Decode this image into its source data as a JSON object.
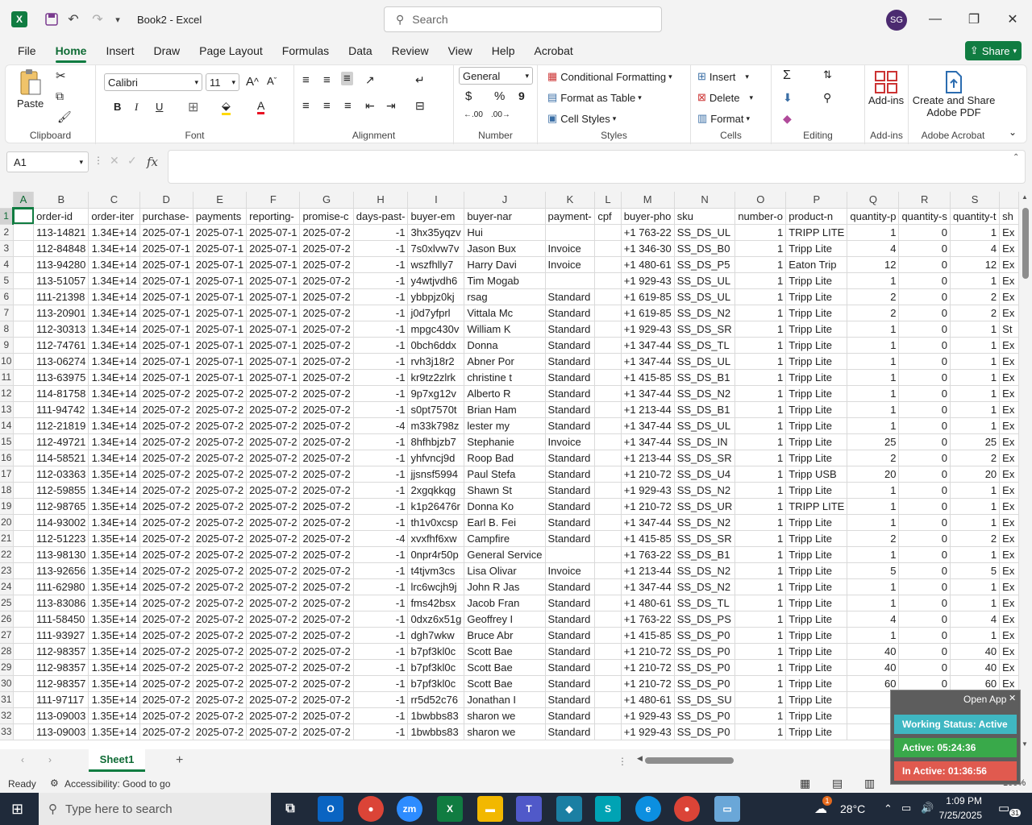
{
  "title_bar": {
    "doc_title": "Book2  -  Excel",
    "search_placeholder": "Search",
    "avatar_initials": "SG"
  },
  "menu": {
    "items": [
      "File",
      "Home",
      "Insert",
      "Draw",
      "Page Layout",
      "Formulas",
      "Data",
      "Review",
      "View",
      "Help",
      "Acrobat"
    ],
    "active": "Home",
    "share_label": "Share"
  },
  "ribbon": {
    "clipboard": {
      "paste": "Paste",
      "label": "Clipboard"
    },
    "font": {
      "name": "Calibri",
      "size": "11",
      "label": "Font",
      "bold": "B",
      "italic": "I",
      "underline": "U"
    },
    "alignment": {
      "label": "Alignment"
    },
    "number": {
      "format": "General",
      "label": "Number",
      "currency": "$",
      "percent": "%",
      "comma": "9"
    },
    "styles": {
      "conditional": "Conditional Formatting",
      "table": "Format as Table",
      "cell": "Cell Styles",
      "label": "Styles"
    },
    "cells": {
      "insert": "Insert",
      "delete": "Delete",
      "format": "Format",
      "label": "Cells"
    },
    "editing": {
      "label": "Editing"
    },
    "addins": {
      "button": "Add-ins",
      "label": "Add-ins"
    },
    "acrobat": {
      "button_line1": "Create and Share",
      "button_line2": "Adobe PDF",
      "label": "Adobe Acrobat"
    }
  },
  "formula_bar": {
    "name_box": "A1",
    "fx": "fx",
    "value": ""
  },
  "grid": {
    "columns": [
      "A",
      "B",
      "C",
      "D",
      "E",
      "F",
      "G",
      "H",
      "I",
      "J",
      "K",
      "L",
      "M",
      "N",
      "O",
      "P",
      "Q",
      "R",
      "S"
    ],
    "header_row": [
      "",
      "order-id",
      "order-iter",
      "purchase-",
      "payments",
      "reporting-",
      "promise-c",
      "days-past-",
      "buyer-em",
      "buyer-nar",
      "payment-",
      "cpf",
      "buyer-pho",
      "sku",
      "number-o",
      "product-n",
      "quantity-p",
      "quantity-s",
      "quantity-t",
      "sh"
    ],
    "rows": [
      [
        "2",
        "",
        "113-14821",
        "1.34E+14",
        "2025-07-1",
        "2025-07-1",
        "2025-07-1",
        "2025-07-2",
        "-1",
        "3hx35yqzv",
        "Hui",
        "",
        "",
        "+1 763-22",
        "SS_DS_UL",
        "1",
        "TRIPP LITE",
        "1",
        "0",
        "1",
        "Ex"
      ],
      [
        "3",
        "",
        "112-84848",
        "1.34E+14",
        "2025-07-1",
        "2025-07-1",
        "2025-07-1",
        "2025-07-2",
        "-1",
        "7s0xlvw7v",
        "Jason Bux",
        "Invoice",
        "",
        "+1 346-30",
        "SS_DS_B0",
        "1",
        "Tripp Lite",
        "4",
        "0",
        "4",
        "Ex"
      ],
      [
        "4",
        "",
        "113-94280",
        "1.34E+14",
        "2025-07-1",
        "2025-07-1",
        "2025-07-1",
        "2025-07-2",
        "-1",
        "wszfhlly7",
        "Harry Davi",
        "Invoice",
        "",
        "+1 480-61",
        "SS_DS_P5",
        "1",
        "Eaton Trip",
        "12",
        "0",
        "12",
        "Ex"
      ],
      [
        "5",
        "",
        "113-51057",
        "1.34E+14",
        "2025-07-1",
        "2025-07-1",
        "2025-07-1",
        "2025-07-2",
        "-1",
        "y4wtjvdh6",
        "Tim Mogab",
        "",
        "",
        "+1 929-43",
        "SS_DS_UL",
        "1",
        "Tripp Lite",
        "1",
        "0",
        "1",
        "Ex"
      ],
      [
        "6",
        "",
        "111-21398",
        "1.34E+14",
        "2025-07-1",
        "2025-07-1",
        "2025-07-1",
        "2025-07-2",
        "-1",
        "ybbpjz0kj",
        "rsag",
        "Standard",
        "",
        "+1 619-85",
        "SS_DS_UL",
        "1",
        "Tripp Lite",
        "2",
        "0",
        "2",
        "Ex"
      ],
      [
        "7",
        "",
        "113-20901",
        "1.34E+14",
        "2025-07-1",
        "2025-07-1",
        "2025-07-1",
        "2025-07-2",
        "-1",
        "j0d7yfprl",
        "Vittala Mc",
        "Standard",
        "",
        "+1 619-85",
        "SS_DS_N2",
        "1",
        "Tripp Lite",
        "2",
        "0",
        "2",
        "Ex"
      ],
      [
        "8",
        "",
        "112-30313",
        "1.34E+14",
        "2025-07-1",
        "2025-07-1",
        "2025-07-1",
        "2025-07-2",
        "-1",
        "mpgc430v",
        "William K",
        "Standard",
        "",
        "+1 929-43",
        "SS_DS_SR",
        "1",
        "Tripp Lite",
        "1",
        "0",
        "1",
        "St"
      ],
      [
        "9",
        "",
        "112-74761",
        "1.34E+14",
        "2025-07-1",
        "2025-07-1",
        "2025-07-1",
        "2025-07-2",
        "-1",
        "0bch6ddx",
        "Donna",
        "Standard",
        "",
        "+1 347-44",
        "SS_DS_TL",
        "1",
        "Tripp Lite",
        "1",
        "0",
        "1",
        "Ex"
      ],
      [
        "10",
        "",
        "113-06274",
        "1.34E+14",
        "2025-07-1",
        "2025-07-1",
        "2025-07-1",
        "2025-07-2",
        "-1",
        "rvh3j18r2",
        "Abner Por",
        "Standard",
        "",
        "+1 347-44",
        "SS_DS_UL",
        "1",
        "Tripp Lite",
        "1",
        "0",
        "1",
        "Ex"
      ],
      [
        "11",
        "",
        "113-63975",
        "1.34E+14",
        "2025-07-1",
        "2025-07-1",
        "2025-07-1",
        "2025-07-2",
        "-1",
        "kr9tz2zlrk",
        "christine t",
        "Standard",
        "",
        "+1 415-85",
        "SS_DS_B1",
        "1",
        "Tripp Lite",
        "1",
        "0",
        "1",
        "Ex"
      ],
      [
        "12",
        "",
        "114-81758",
        "1.34E+14",
        "2025-07-2",
        "2025-07-2",
        "2025-07-2",
        "2025-07-2",
        "-1",
        "9p7xg12v",
        "Alberto R",
        "Standard",
        "",
        "+1 347-44",
        "SS_DS_N2",
        "1",
        "Tripp Lite",
        "1",
        "0",
        "1",
        "Ex"
      ],
      [
        "13",
        "",
        "111-94742",
        "1.34E+14",
        "2025-07-2",
        "2025-07-2",
        "2025-07-2",
        "2025-07-2",
        "-1",
        "s0pt7570t",
        "Brian Ham",
        "Standard",
        "",
        "+1 213-44",
        "SS_DS_B1",
        "1",
        "Tripp Lite",
        "1",
        "0",
        "1",
        "Ex"
      ],
      [
        "14",
        "",
        "112-21819",
        "1.34E+14",
        "2025-07-2",
        "2025-07-2",
        "2025-07-2",
        "2025-07-2",
        "-4",
        "m33k798z",
        "lester my",
        "Standard",
        "",
        "+1 347-44",
        "SS_DS_UL",
        "1",
        "Tripp Lite",
        "1",
        "0",
        "1",
        "Ex"
      ],
      [
        "15",
        "",
        "112-49721",
        "1.34E+14",
        "2025-07-2",
        "2025-07-2",
        "2025-07-2",
        "2025-07-2",
        "-1",
        "8hfhbjzb7",
        "Stephanie",
        "Invoice",
        "",
        "+1 347-44",
        "SS_DS_IN",
        "1",
        "Tripp Lite",
        "25",
        "0",
        "25",
        "Ex"
      ],
      [
        "16",
        "",
        "114-58521",
        "1.34E+14",
        "2025-07-2",
        "2025-07-2",
        "2025-07-2",
        "2025-07-2",
        "-1",
        "yhfvncj9d",
        "Roop Bad",
        "Standard",
        "",
        "+1 213-44",
        "SS_DS_SR",
        "1",
        "Tripp Lite",
        "2",
        "0",
        "2",
        "Ex"
      ],
      [
        "17",
        "",
        "112-03363",
        "1.35E+14",
        "2025-07-2",
        "2025-07-2",
        "2025-07-2",
        "2025-07-2",
        "-1",
        "jjsnsf5994",
        "Paul Stefa",
        "Standard",
        "",
        "+1 210-72",
        "SS_DS_U4",
        "1",
        "Tripp USB",
        "20",
        "0",
        "20",
        "Ex"
      ],
      [
        "18",
        "",
        "112-59855",
        "1.34E+14",
        "2025-07-2",
        "2025-07-2",
        "2025-07-2",
        "2025-07-2",
        "-1",
        "2xgqkkqg",
        "Shawn St",
        "Standard",
        "",
        "+1 929-43",
        "SS_DS_N2",
        "1",
        "Tripp Lite",
        "1",
        "0",
        "1",
        "Ex"
      ],
      [
        "19",
        "",
        "112-98765",
        "1.35E+14",
        "2025-07-2",
        "2025-07-2",
        "2025-07-2",
        "2025-07-2",
        "-1",
        "k1p26476r",
        "Donna Ko",
        "Standard",
        "",
        "+1 210-72",
        "SS_DS_UR",
        "1",
        "TRIPP LITE",
        "1",
        "0",
        "1",
        "Ex"
      ],
      [
        "20",
        "",
        "114-93002",
        "1.34E+14",
        "2025-07-2",
        "2025-07-2",
        "2025-07-2",
        "2025-07-2",
        "-1",
        "th1v0xcsp",
        "Earl B. Fei",
        "Standard",
        "",
        "+1 347-44",
        "SS_DS_N2",
        "1",
        "Tripp Lite",
        "1",
        "0",
        "1",
        "Ex"
      ],
      [
        "21",
        "",
        "112-51223",
        "1.35E+14",
        "2025-07-2",
        "2025-07-2",
        "2025-07-2",
        "2025-07-2",
        "-4",
        "xvxfhf6xw",
        "Campfire",
        "Standard",
        "",
        "+1 415-85",
        "SS_DS_SR",
        "1",
        "Tripp Lite",
        "2",
        "0",
        "2",
        "Ex"
      ],
      [
        "22",
        "",
        "113-98130",
        "1.35E+14",
        "2025-07-2",
        "2025-07-2",
        "2025-07-2",
        "2025-07-2",
        "-1",
        "0npr4r50p",
        "General Service",
        "",
        "",
        "+1 763-22",
        "SS_DS_B1",
        "1",
        "Tripp Lite",
        "1",
        "0",
        "1",
        "Ex"
      ],
      [
        "23",
        "",
        "113-92656",
        "1.35E+14",
        "2025-07-2",
        "2025-07-2",
        "2025-07-2",
        "2025-07-2",
        "-1",
        "t4tjvm3cs",
        "Lisa Olivar",
        "Invoice",
        "",
        "+1 213-44",
        "SS_DS_N2",
        "1",
        "Tripp Lite",
        "5",
        "0",
        "5",
        "Ex"
      ],
      [
        "24",
        "",
        "111-62980",
        "1.35E+14",
        "2025-07-2",
        "2025-07-2",
        "2025-07-2",
        "2025-07-2",
        "-1",
        "lrc6wcjh9j",
        "John R Jas",
        "Standard",
        "",
        "+1 347-44",
        "SS_DS_N2",
        "1",
        "Tripp Lite",
        "1",
        "0",
        "1",
        "Ex"
      ],
      [
        "25",
        "",
        "113-83086",
        "1.35E+14",
        "2025-07-2",
        "2025-07-2",
        "2025-07-2",
        "2025-07-2",
        "-1",
        "fms42bsx",
        "Jacob Fran",
        "Standard",
        "",
        "+1 480-61",
        "SS_DS_TL",
        "1",
        "Tripp Lite",
        "1",
        "0",
        "1",
        "Ex"
      ],
      [
        "26",
        "",
        "111-58450",
        "1.35E+14",
        "2025-07-2",
        "2025-07-2",
        "2025-07-2",
        "2025-07-2",
        "-1",
        "0dxz6x51g",
        "Geoffrey I",
        "Standard",
        "",
        "+1 763-22",
        "SS_DS_PS",
        "1",
        "Tripp Lite",
        "4",
        "0",
        "4",
        "Ex"
      ],
      [
        "27",
        "",
        "111-93927",
        "1.35E+14",
        "2025-07-2",
        "2025-07-2",
        "2025-07-2",
        "2025-07-2",
        "-1",
        "dgh7wkw",
        "Bruce Abr",
        "Standard",
        "",
        "+1 415-85",
        "SS_DS_P0",
        "1",
        "Tripp Lite",
        "1",
        "0",
        "1",
        "Ex"
      ],
      [
        "28",
        "",
        "112-98357",
        "1.35E+14",
        "2025-07-2",
        "2025-07-2",
        "2025-07-2",
        "2025-07-2",
        "-1",
        "b7pf3kl0c",
        "Scott Bae",
        "Standard",
        "",
        "+1 210-72",
        "SS_DS_P0",
        "1",
        "Tripp Lite",
        "40",
        "0",
        "40",
        "Ex"
      ],
      [
        "29",
        "",
        "112-98357",
        "1.35E+14",
        "2025-07-2",
        "2025-07-2",
        "2025-07-2",
        "2025-07-2",
        "-1",
        "b7pf3kl0c",
        "Scott Bae",
        "Standard",
        "",
        "+1 210-72",
        "SS_DS_P0",
        "1",
        "Tripp Lite",
        "40",
        "0",
        "40",
        "Ex"
      ],
      [
        "30",
        "",
        "112-98357",
        "1.35E+14",
        "2025-07-2",
        "2025-07-2",
        "2025-07-2",
        "2025-07-2",
        "-1",
        "b7pf3kl0c",
        "Scott Bae",
        "Standard",
        "",
        "+1 210-72",
        "SS_DS_P0",
        "1",
        "Tripp Lite",
        "60",
        "0",
        "60",
        "Ex"
      ],
      [
        "31",
        "",
        "111-97117",
        "1.35E+14",
        "2025-07-2",
        "2025-07-2",
        "2025-07-2",
        "2025-07-2",
        "-1",
        "rr5d52c76",
        "Jonathan I",
        "Standard",
        "",
        "+1 480-61",
        "SS_DS_SU",
        "1",
        "Tripp Lite",
        "1",
        "0",
        "",
        ""
      ],
      [
        "32",
        "",
        "113-09003",
        "1.35E+14",
        "2025-07-2",
        "2025-07-2",
        "2025-07-2",
        "2025-07-2",
        "-1",
        "1bwbbs83",
        "sharon we",
        "Standard",
        "",
        "+1 929-43",
        "SS_DS_P0",
        "1",
        "Tripp Lite",
        "4",
        "",
        "",
        ""
      ],
      [
        "33",
        "",
        "113-09003",
        "1.35E+14",
        "2025-07-2",
        "2025-07-2",
        "2025-07-2",
        "2025-07-2",
        "-1",
        "1bwbbs83",
        "sharon we",
        "Standard",
        "",
        "+1 929-43",
        "SS_DS_P0",
        "1",
        "Tripp Lite",
        "6",
        "",
        "",
        ""
      ]
    ]
  },
  "sheet_tabs": {
    "active": "Sheet1",
    "add": "+"
  },
  "status": {
    "ready": "Ready",
    "accessibility": "Accessibility: Good to go",
    "zoom": "100%"
  },
  "widget": {
    "open_app": "Open App",
    "working": "Working Status: Active",
    "active": "Active: 05:24:36",
    "inactive": "In Active: 01:36:56"
  },
  "taskbar": {
    "search_placeholder": "Type here to search",
    "temperature": "28°C",
    "time": "1:09 PM",
    "date": "7/25/2025",
    "notif_count": "31",
    "weather_badge": "1"
  },
  "colors": {
    "excel_green": "#107c41",
    "widget_teal": "#3fb7c2",
    "widget_green": "#39a94a",
    "widget_red": "#e05a4f"
  }
}
